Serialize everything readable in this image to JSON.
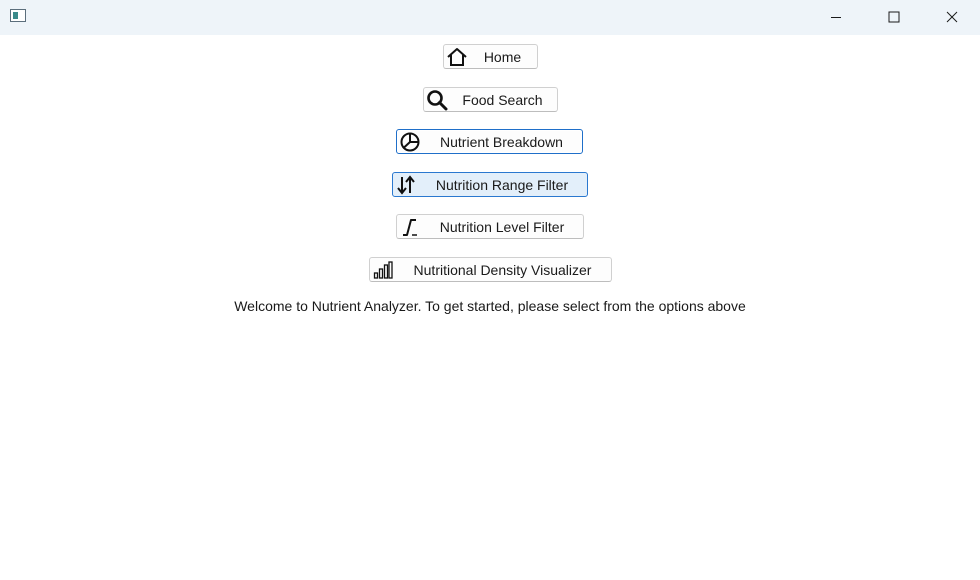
{
  "window": {
    "controls": {
      "minimize": "minimize-icon",
      "maximize": "maximize-icon",
      "close": "close-icon"
    }
  },
  "nav": {
    "buttons": [
      {
        "label": "Home",
        "icon": "home-icon"
      },
      {
        "label": "Food Search",
        "icon": "search-icon"
      },
      {
        "label": "Nutrient Breakdown",
        "icon": "pie-chart-icon"
      },
      {
        "label": "Nutrition Range Filter",
        "icon": "sort-arrows-icon"
      },
      {
        "label": "Nutrition Level Filter",
        "icon": "step-function-icon"
      },
      {
        "label": "Nutritional Density Visualizer",
        "icon": "bar-chart-icon"
      }
    ]
  },
  "welcome_text": "Welcome to Nutrient Analyzer. To get started, please select from the options above",
  "colors": {
    "titlebar": "#eef4f9",
    "focus_border": "#1f6fc9",
    "hover_background": "#e3effa"
  }
}
